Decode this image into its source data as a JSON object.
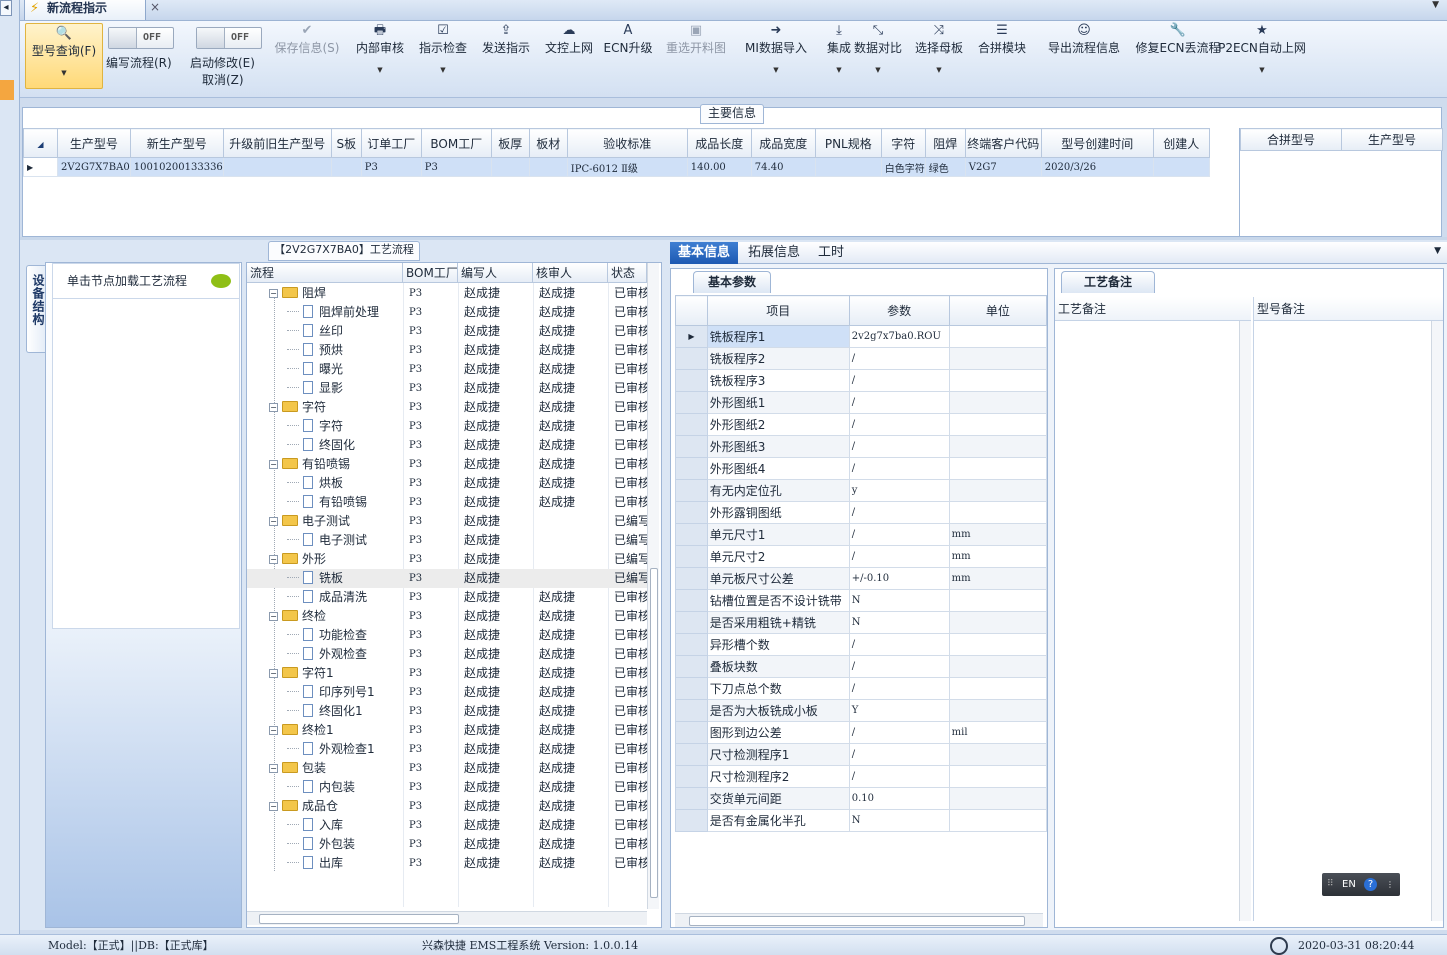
{
  "window": {
    "doc_tab": "新流程指示",
    "tab_close": "×",
    "pin_icon": "pin-icon"
  },
  "toolbar": {
    "query_label": "型号查询(F)",
    "toggle_write": {
      "state": "OFF",
      "label": "编写流程(R)"
    },
    "toggle_modify": {
      "state": "OFF",
      "label": "启动修改(E)",
      "sub_label": "取消(Z)"
    },
    "buttons": [
      {
        "label": "保存信息(S)",
        "icon": "✔",
        "disabled": true,
        "dropdown": false
      },
      {
        "label": "内部审核",
        "icon": "🖶",
        "disabled": false,
        "dropdown": true
      },
      {
        "label": "指示检查",
        "icon": "☑",
        "disabled": false,
        "dropdown": true
      },
      {
        "label": "发送指示",
        "icon": "⇪",
        "disabled": false,
        "dropdown": false
      },
      {
        "label": "文控上网",
        "icon": "☁",
        "disabled": false,
        "dropdown": false
      },
      {
        "label": "ECN升级",
        "icon": "A",
        "disabled": false,
        "dropdown": false
      },
      {
        "label": "重选开料图",
        "icon": "▣",
        "disabled": true,
        "dropdown": false
      },
      {
        "label": "MI数据导入",
        "icon": "➜",
        "disabled": false,
        "dropdown": true
      },
      {
        "label": "集成",
        "icon": "⤓",
        "disabled": false,
        "dropdown": true
      },
      {
        "label": "数据对比",
        "icon": "⤡",
        "disabled": false,
        "dropdown": true
      },
      {
        "label": "选择母板",
        "icon": "⤨",
        "disabled": false,
        "dropdown": true
      },
      {
        "label": "合拼模块",
        "icon": "☰",
        "disabled": false,
        "dropdown": false
      },
      {
        "label": "导出流程信息",
        "icon": "☺",
        "disabled": false,
        "dropdown": false
      },
      {
        "label": "修复ECN丢流程",
        "icon": "🔧",
        "disabled": false,
        "dropdown": false
      },
      {
        "label": "P2ECN自动上网",
        "icon": "★",
        "disabled": false,
        "dropdown": true
      }
    ]
  },
  "main_info": {
    "title": "主要信息",
    "columns": [
      "生产型号",
      "新生产型号",
      "升级前旧生产型号",
      "S板",
      "订单工厂",
      "BOM工厂",
      "板厚",
      "板材",
      "验收标准",
      "成品长度",
      "成品宽度",
      "PNL规格",
      "字符",
      "阻焊",
      "终端客户代码",
      "型号创建时间",
      "创建人"
    ],
    "rows": [
      [
        "2V2G7X7BA0",
        "10010200133336",
        "",
        "",
        "P3",
        "P3",
        "",
        "",
        "IPC-6012 Ⅱ级",
        "140.00",
        "74.40",
        "",
        "白色字符",
        "绿色",
        "V2G7",
        "2020/3/26",
        ""
      ]
    ],
    "side_columns": [
      "合拼型号",
      "生产型号"
    ]
  },
  "left_panel": {
    "vertical_tab": "设备结构",
    "header": "单击节点加载工艺流程"
  },
  "process_tree": {
    "title": "【2V2G7X7BA0】工艺流程",
    "columns": [
      "流程",
      "BOM工厂",
      "编写人",
      "核审人",
      "状态"
    ],
    "rows": [
      {
        "name": "阻焊",
        "folder": true,
        "bom": "P3",
        "writer": "赵成捷",
        "reviewer": "赵成捷",
        "status": "已审核"
      },
      {
        "name": "阻焊前处理",
        "folder": false,
        "bom": "P3",
        "writer": "赵成捷",
        "reviewer": "赵成捷",
        "status": "已审核"
      },
      {
        "name": "丝印",
        "folder": false,
        "bom": "P3",
        "writer": "赵成捷",
        "reviewer": "赵成捷",
        "status": "已审核"
      },
      {
        "name": "预烘",
        "folder": false,
        "bom": "P3",
        "writer": "赵成捷",
        "reviewer": "赵成捷",
        "status": "已审核"
      },
      {
        "name": "曝光",
        "folder": false,
        "bom": "P3",
        "writer": "赵成捷",
        "reviewer": "赵成捷",
        "status": "已审核"
      },
      {
        "name": "显影",
        "folder": false,
        "bom": "P3",
        "writer": "赵成捷",
        "reviewer": "赵成捷",
        "status": "已审核"
      },
      {
        "name": "字符",
        "folder": true,
        "bom": "P3",
        "writer": "赵成捷",
        "reviewer": "赵成捷",
        "status": "已审核"
      },
      {
        "name": "字符",
        "folder": false,
        "bom": "P3",
        "writer": "赵成捷",
        "reviewer": "赵成捷",
        "status": "已审核"
      },
      {
        "name": "终固化",
        "folder": false,
        "bom": "P3",
        "writer": "赵成捷",
        "reviewer": "赵成捷",
        "status": "已审核"
      },
      {
        "name": "有铅喷锡",
        "folder": true,
        "bom": "P3",
        "writer": "赵成捷",
        "reviewer": "赵成捷",
        "status": "已审核"
      },
      {
        "name": "烘板",
        "folder": false,
        "bom": "P3",
        "writer": "赵成捷",
        "reviewer": "赵成捷",
        "status": "已审核"
      },
      {
        "name": "有铅喷锡",
        "folder": false,
        "bom": "P3",
        "writer": "赵成捷",
        "reviewer": "赵成捷",
        "status": "已审核"
      },
      {
        "name": "电子测试",
        "folder": true,
        "bom": "P3",
        "writer": "赵成捷",
        "reviewer": "",
        "status": "已编写"
      },
      {
        "name": "电子测试",
        "folder": false,
        "bom": "P3",
        "writer": "赵成捷",
        "reviewer": "",
        "status": "已编写"
      },
      {
        "name": "外形",
        "folder": true,
        "bom": "P3",
        "writer": "赵成捷",
        "reviewer": "",
        "status": "已编写"
      },
      {
        "name": "铣板",
        "folder": false,
        "bom": "P3",
        "writer": "赵成捷",
        "reviewer": "",
        "status": "已编写",
        "selected": true
      },
      {
        "name": "成品清洗",
        "folder": false,
        "bom": "P3",
        "writer": "赵成捷",
        "reviewer": "赵成捷",
        "status": "已审核"
      },
      {
        "name": "终检",
        "folder": true,
        "bom": "P3",
        "writer": "赵成捷",
        "reviewer": "赵成捷",
        "status": "已审核"
      },
      {
        "name": "功能检查",
        "folder": false,
        "bom": "P3",
        "writer": "赵成捷",
        "reviewer": "赵成捷",
        "status": "已审核"
      },
      {
        "name": "外观检查",
        "folder": false,
        "bom": "P3",
        "writer": "赵成捷",
        "reviewer": "赵成捷",
        "status": "已审核"
      },
      {
        "name": "字符1",
        "folder": true,
        "bom": "P3",
        "writer": "赵成捷",
        "reviewer": "赵成捷",
        "status": "已审核"
      },
      {
        "name": "印序列号1",
        "folder": false,
        "bom": "P3",
        "writer": "赵成捷",
        "reviewer": "赵成捷",
        "status": "已审核"
      },
      {
        "name": "终固化1",
        "folder": false,
        "bom": "P3",
        "writer": "赵成捷",
        "reviewer": "赵成捷",
        "status": "已审核"
      },
      {
        "name": "终检1",
        "folder": true,
        "bom": "P3",
        "writer": "赵成捷",
        "reviewer": "赵成捷",
        "status": "已审核"
      },
      {
        "name": "外观检查1",
        "folder": false,
        "bom": "P3",
        "writer": "赵成捷",
        "reviewer": "赵成捷",
        "status": "已审核"
      },
      {
        "name": "包装",
        "folder": true,
        "bom": "P3",
        "writer": "赵成捷",
        "reviewer": "赵成捷",
        "status": "已审核"
      },
      {
        "name": "内包装",
        "folder": false,
        "bom": "P3",
        "writer": "赵成捷",
        "reviewer": "赵成捷",
        "status": "已审核"
      },
      {
        "name": "成品仓",
        "folder": true,
        "bom": "P3",
        "writer": "赵成捷",
        "reviewer": "赵成捷",
        "status": "已审核"
      },
      {
        "name": "入库",
        "folder": false,
        "bom": "P3",
        "writer": "赵成捷",
        "reviewer": "赵成捷",
        "status": "已审核"
      },
      {
        "name": "外包装",
        "folder": false,
        "bom": "P3",
        "writer": "赵成捷",
        "reviewer": "赵成捷",
        "status": "已审核"
      },
      {
        "name": "出库",
        "folder": false,
        "bom": "P3",
        "writer": "赵成捷",
        "reviewer": "赵成捷",
        "status": "已审核"
      }
    ]
  },
  "right_tabs": [
    "基本信息",
    "拓展信息",
    "工时"
  ],
  "basic_params": {
    "subtab": "基本参数",
    "columns": [
      "项目",
      "参数",
      "单位"
    ],
    "rows": [
      [
        "铣板程序1",
        "2v2g7x7ba0.ROU",
        ""
      ],
      [
        "铣板程序2",
        "/",
        ""
      ],
      [
        "铣板程序3",
        "/",
        ""
      ],
      [
        "外形图纸1",
        "/",
        ""
      ],
      [
        "外形图纸2",
        "/",
        ""
      ],
      [
        "外形图纸3",
        "/",
        ""
      ],
      [
        "外形图纸4",
        "/",
        ""
      ],
      [
        "有无内定位孔",
        "y",
        ""
      ],
      [
        "外形露铜图纸",
        "/",
        ""
      ],
      [
        "单元尺寸1",
        "/",
        "mm"
      ],
      [
        "单元尺寸2",
        "/",
        "mm"
      ],
      [
        "单元板尺寸公差",
        "+/-0.10",
        "mm"
      ],
      [
        "钻槽位置是否不设计铣带",
        "N",
        ""
      ],
      [
        "是否采用粗铣+精铣",
        "N",
        ""
      ],
      [
        "异形槽个数",
        "/",
        ""
      ],
      [
        "叠板块数",
        "/",
        ""
      ],
      [
        "下刀点总个数",
        "/",
        ""
      ],
      [
        "是否为大板铣成小板",
        "Y",
        ""
      ],
      [
        "图形到边公差",
        "/",
        "mil"
      ],
      [
        "尺寸检测程序1",
        "/",
        ""
      ],
      [
        "尺寸检测程序2",
        "/",
        ""
      ],
      [
        "交货单元间距",
        "0.10",
        ""
      ],
      [
        "是否有金属化半孔",
        "N",
        ""
      ]
    ]
  },
  "notes": {
    "subtab": "工艺备注",
    "col1": "工艺备注",
    "col2": "型号备注"
  },
  "ime": {
    "label": "EN"
  },
  "status": {
    "left": "Model:【正式】||DB:【正式库】",
    "center": "兴森快捷 EMS工程系统 Version: 1.0.0.14",
    "time": "2020-03-31 08:20:44"
  }
}
